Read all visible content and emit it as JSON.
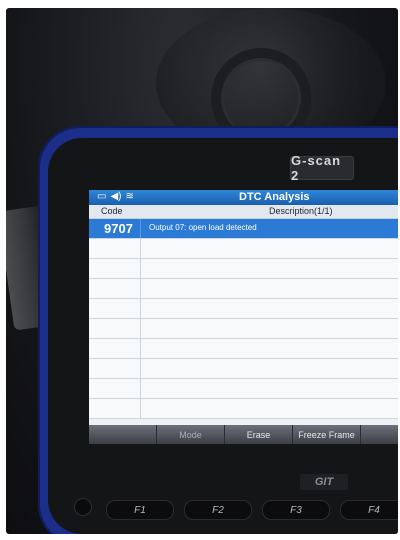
{
  "device": {
    "brand": "G-scan 2",
    "logo_bottom": "GIT",
    "hardware_keys": [
      "F1",
      "F2",
      "F3",
      "F4"
    ]
  },
  "screen": {
    "title": "DTC Analysis",
    "status_icons": [
      "battery-icon",
      "speaker-icon",
      "wifi-icon"
    ],
    "columns": {
      "code": "Code",
      "description": "Description(1/1)"
    },
    "rows": [
      {
        "code": "9707",
        "description": "Output 07: open load detected",
        "selected": true
      }
    ],
    "empty_row_count": 9,
    "function_bar": [
      "",
      "Mode",
      "Erase",
      "Freeze Frame",
      ""
    ]
  },
  "colors": {
    "titlebar": "#1a5fae",
    "selected_row": "#2a7ad6",
    "device_body": "#1b2f8a"
  }
}
